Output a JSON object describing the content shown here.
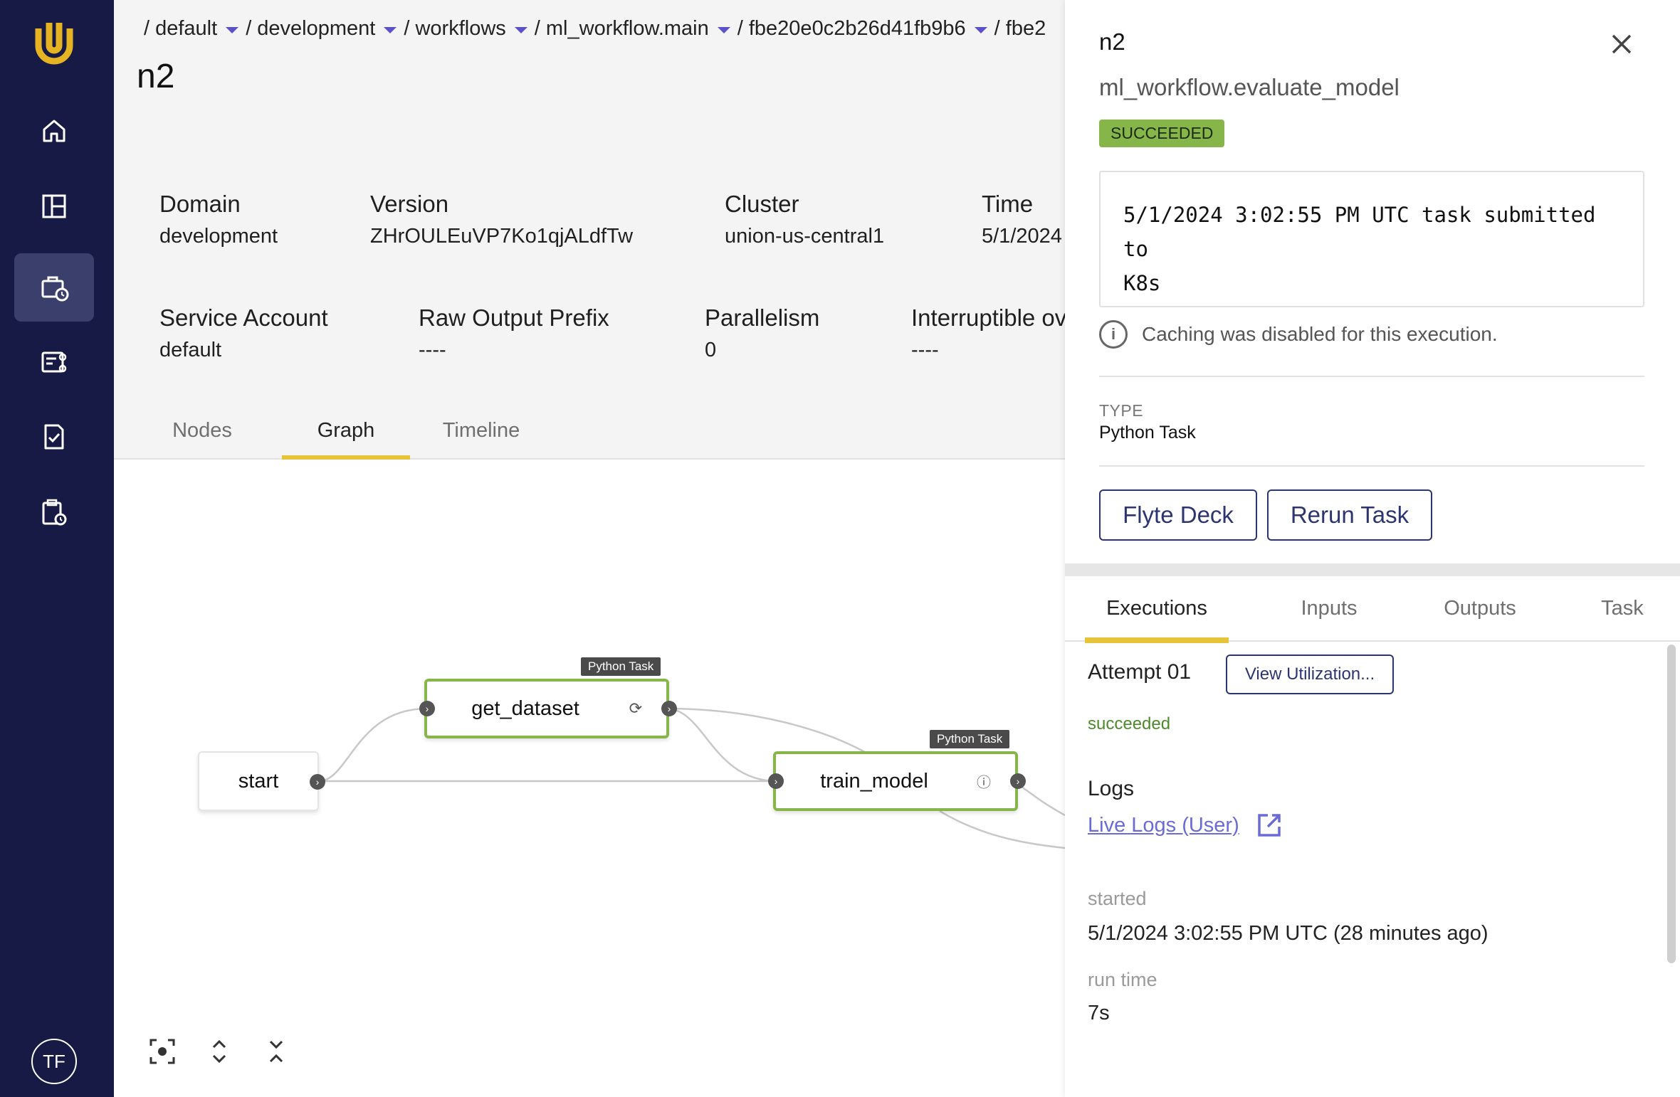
{
  "app": {
    "accent_color": "#e6c43a",
    "nav_bg": "#171a44",
    "success_color": "#86b64a"
  },
  "nav": {
    "items": [
      {
        "icon": "home-icon"
      },
      {
        "icon": "dashboard-icon"
      },
      {
        "icon": "executions-icon",
        "active": true
      },
      {
        "icon": "workflows-icon"
      },
      {
        "icon": "tasks-icon"
      },
      {
        "icon": "schedules-icon"
      }
    ],
    "avatar": "TF"
  },
  "breadcrumb": [
    "/ default",
    "/ development",
    "/ workflows",
    "/ ml_workflow.main",
    "/ fbe20e0c2b26d41fb9b6",
    "/ fbe2"
  ],
  "page": {
    "title": "n2",
    "meta": {
      "domain_label": "Domain",
      "domain_value": "development",
      "version_label": "Version",
      "version_value": "ZHrOULEuVP7Ko1qjALdfTw",
      "cluster_label": "Cluster",
      "cluster_value": "union-us-central1",
      "time_label": "Time",
      "time_value": "5/1/2024",
      "sa_label": "Service Account",
      "sa_value": "default",
      "rop_label": "Raw Output Prefix",
      "rop_value": "----",
      "par_label": "Parallelism",
      "par_value": "0",
      "int_label": "Interruptible ov",
      "int_value": "----"
    },
    "tabs": [
      "Nodes",
      "Graph",
      "Timeline"
    ],
    "active_tab": "Graph"
  },
  "graph": {
    "nodes": {
      "start": "start",
      "get_dataset": "get_dataset",
      "train_model": "train_model"
    },
    "tag": "Python Task"
  },
  "panel": {
    "title": "n2",
    "subtitle": "ml_workflow.evaluate_model",
    "status": "SUCCEEDED",
    "log_line1": "5/1/2024 3:02:55 PM UTC task submitted to",
    "log_line2": "K8s",
    "cache_note": "Caching was disabled for this execution.",
    "type_label": "TYPE",
    "type_value": "Python Task",
    "flyte_deck": "Flyte Deck",
    "rerun_task": "Rerun Task",
    "tabs": [
      "Executions",
      "Inputs",
      "Outputs",
      "Task"
    ],
    "active_tab": "Executions",
    "attempt": "Attempt 01",
    "view_utilization": "View Utilization...",
    "attempt_status": "succeeded",
    "logs_label": "Logs",
    "live_logs": "Live Logs (User)",
    "started_label": "started",
    "started_value": "5/1/2024 3:02:55 PM UTC (28 minutes ago)",
    "runtime_label": "run time",
    "runtime_value": "7s"
  }
}
